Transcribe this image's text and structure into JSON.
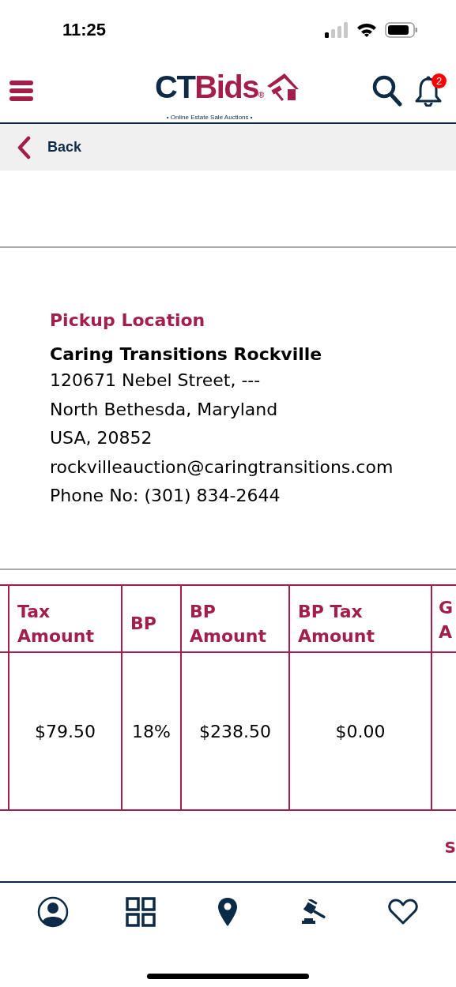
{
  "status_bar": {
    "time": "11:25"
  },
  "header": {
    "logo": {
      "part_1": "CT",
      "part_2": "Bids",
      "registered": "®",
      "tagline": "• Online Estate Sale Auctions •"
    },
    "notification_count": "2"
  },
  "back_bar": {
    "label": "Back"
  },
  "pickup": {
    "heading": "Pickup Location",
    "name": "Caring Transitions Rockville",
    "lines": [
      "120671 Nebel Street, ---",
      "North Bethesda, Maryland",
      "USA, 20852",
      "rockvilleauction@caringtransitions.com",
      "Phone No: (301) 834-2644"
    ]
  },
  "fees_table": {
    "columns": [
      "Tax Amount",
      "BP",
      "BP Amount",
      "BP Tax Amount",
      "G A"
    ],
    "rows": [
      [
        "$79.50",
        "18%",
        "$238.50",
        "$0.00"
      ]
    ]
  },
  "summary_label": "S",
  "tab_bar": {
    "items": [
      {
        "kind": "account"
      },
      {
        "kind": "grid"
      },
      {
        "kind": "location"
      },
      {
        "kind": "auction"
      },
      {
        "kind": "favorites"
      }
    ]
  }
}
